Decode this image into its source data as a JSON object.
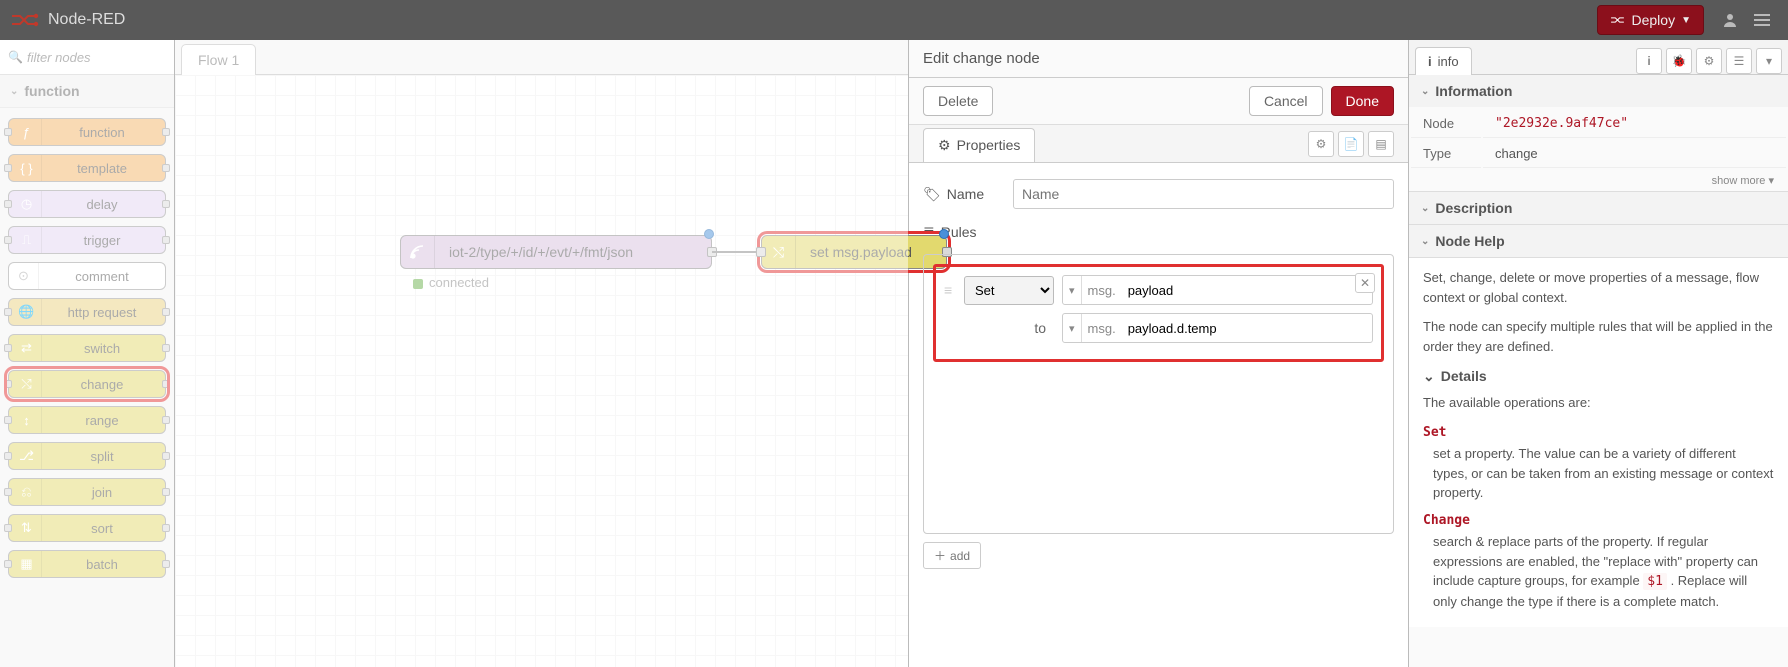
{
  "brand": "Node-RED",
  "header": {
    "deploy_label": "Deploy"
  },
  "palette": {
    "search_placeholder": "filter nodes",
    "category": "function",
    "nodes": {
      "function": "function",
      "template": "template",
      "delay": "delay",
      "trigger": "trigger",
      "comment": "comment",
      "http": "http request",
      "switch": "switch",
      "change": "change",
      "range": "range",
      "split": "split",
      "join": "join",
      "sort": "sort",
      "batch": "batch"
    }
  },
  "workspace": {
    "tab": "Flow 1",
    "mqtt_label": "iot-2/type/+/id/+/evt/+/fmt/json",
    "mqtt_status": "connected",
    "change_label": "set msg.payload"
  },
  "edit": {
    "title": "Edit change node",
    "delete": "Delete",
    "cancel": "Cancel",
    "done": "Done",
    "properties": "Properties",
    "name_label": "Name",
    "name_placeholder": "Name",
    "rules_label": "Rules",
    "rule_action": "Set",
    "rule_prefix": "msg.",
    "rule_target": "payload",
    "rule_to": "to",
    "rule_value": "payload.d.temp",
    "add": "add"
  },
  "sidebar": {
    "tab_info": "info",
    "section_information": "Information",
    "info_node": "Node",
    "info_node_id": "\"2e2932e.9af47ce\"",
    "info_type": "Type",
    "info_type_val": "change",
    "show_more": "show more ▾",
    "section_description": "Description",
    "section_help": "Node Help",
    "help_p1": "Set, change, delete or move properties of a message, flow context or global context.",
    "help_p2": "The node can specify multiple rules that will be applied in the order they are defined.",
    "details_title": "Details",
    "details_intro": "The available operations are:",
    "op_set": "Set",
    "op_set_desc": "set a property. The value can be a variety of different types, or can be taken from an existing message or context property.",
    "op_change": "Change",
    "op_change_desc_pre": "search & replace parts of the property. If regular expressions are enabled, the \"replace with\" property can include capture groups, for example ",
    "op_change_code": "$1",
    "op_change_desc_post": " . Replace will only change the type if there is a complete match."
  }
}
